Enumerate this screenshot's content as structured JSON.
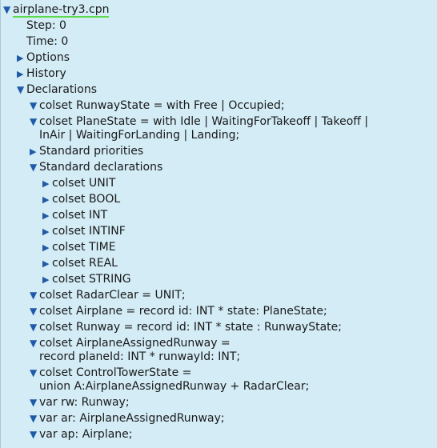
{
  "icons": {
    "expanded": "expanded-triangle-icon",
    "collapsed": "collapsed-triangle-icon"
  },
  "colors": {
    "background": "#d3ecf6",
    "triangle": "#1f5aa8",
    "root_underline": "#5bd84b"
  },
  "tree": {
    "root": "airplane-try3.cpn",
    "step": "Step: 0",
    "time": "Time: 0",
    "options": "Options",
    "history": "History",
    "declarations": "Declarations",
    "decl": {
      "runway_state": "colset RunwayState = with Free | Occupied;",
      "plane_state_1": "colset PlaneState = with Idle | WaitingForTakeoff | Takeoff |",
      "plane_state_2": "InAir | WaitingForLanding | Landing;",
      "std_priorities": "Standard priorities",
      "std_declarations": "Standard declarations",
      "std": {
        "unit": "colset UNIT",
        "bool": "colset BOOL",
        "int": "colset INT",
        "intinf": "colset INTINF",
        "time": "colset TIME",
        "real": "colset REAL",
        "string": "colset STRING"
      },
      "radar_clear": "colset RadarClear = UNIT;",
      "airplane": "colset Airplane = record id: INT * state: PlaneState;",
      "runway": "colset Runway = record id: INT * state : RunwayState;",
      "assigned_1": "colset AirplaneAssignedRunway =",
      "assigned_2": "record planeId: INT * runwayId: INT;",
      "tower_1": "colset ControlTowerState =",
      "tower_2": "union A:AirplaneAssignedRunway + RadarClear;",
      "var_rw": "var rw: Runway;",
      "var_ar": "var ar: AirplaneAssignedRunway;",
      "var_ap": "var ap: Airplane;"
    }
  }
}
